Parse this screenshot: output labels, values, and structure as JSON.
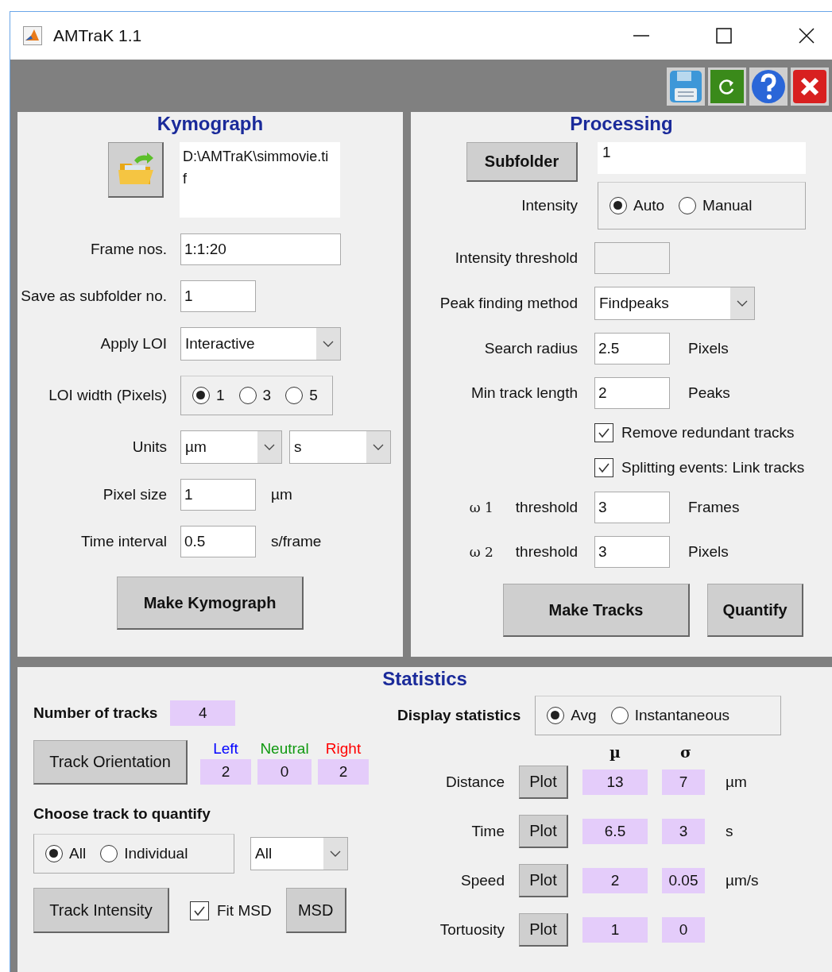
{
  "window": {
    "title": "AMTraK 1.1"
  },
  "toolbar": [
    {
      "kind": "save"
    },
    {
      "kind": "refresh"
    },
    {
      "kind": "help"
    },
    {
      "kind": "close"
    }
  ],
  "kymograph": {
    "title": "Kymograph",
    "file_path": "D:\\AMTraK\\simmovie.tif",
    "rows": [
      {
        "kind": "wide_text",
        "label": "Frame nos.",
        "value": "1:1:20"
      },
      {
        "kind": "text",
        "label": "Save as subfolder no.",
        "value": "1"
      },
      {
        "kind": "dropdown",
        "label": "Apply  LOI",
        "values": [
          "Interactive"
        ]
      },
      {
        "kind": "radio",
        "label": "LOI width (Pixels)",
        "options": [
          {
            "label": "1",
            "selected": true
          },
          {
            "label": "3",
            "selected": false
          },
          {
            "label": "5",
            "selected": false
          }
        ]
      },
      {
        "kind": "dropdown",
        "label": "Units",
        "values": [
          "µm",
          "s"
        ]
      },
      {
        "kind": "text",
        "label": "Pixel size",
        "value": "1",
        "unit": "µm"
      },
      {
        "kind": "text",
        "label": "Time interval",
        "value": "0.5",
        "unit": "s/frame"
      }
    ],
    "button": "Make Kymograph"
  },
  "processing": {
    "title": "Processing",
    "subfolder_button": "Subfolder",
    "subfolder_value": "1",
    "rows": [
      {
        "kind": "radio",
        "label": "Intensity",
        "options": [
          {
            "label": "Auto",
            "selected": true
          },
          {
            "label": "Manual",
            "selected": false
          }
        ]
      },
      {
        "kind": "text",
        "label": "Intensity threshold",
        "disabled": true
      },
      {
        "kind": "dropdown",
        "label": "Peak finding method",
        "values": [
          "Findpeaks"
        ]
      },
      {
        "kind": "text",
        "label": "Search radius",
        "value": "2.5",
        "unit": "Pixels"
      },
      {
        "kind": "text",
        "label": "Min track length",
        "value": "2",
        "unit": "Peaks"
      },
      {
        "kind": "checkbox",
        "label": "Remove redundant tracks",
        "checked": true
      },
      {
        "kind": "checkbox",
        "label": "Splitting events: Link tracks",
        "checked": true
      },
      {
        "kind": "text",
        "symbol": "ω 1",
        "label": "threshold",
        "value": "3",
        "unit": "Frames"
      },
      {
        "kind": "text",
        "symbol": "ω 2",
        "label": "threshold",
        "value": "3",
        "unit": "Pixels"
      }
    ],
    "buttons": [
      "Make Tracks",
      "Quantify"
    ]
  },
  "statistics": {
    "title": "Statistics",
    "number_of_tracks": {
      "label": "Number of tracks",
      "value": "4"
    },
    "orientation_button": "Track Orientation",
    "orientation": [
      {
        "label": "Left",
        "value": "2",
        "color": "#0000ff"
      },
      {
        "label": "Neutral",
        "value": "0",
        "color": "#119911"
      },
      {
        "label": "Right",
        "value": "2",
        "color": "#ff0000"
      }
    ],
    "choose_label": "Choose track to quantify",
    "choose_options": [
      {
        "label": "All",
        "selected": true
      },
      {
        "label": "Individual",
        "selected": false
      }
    ],
    "track_dropdown": "All",
    "intensity_button": "Track Intensity",
    "fit_msd": {
      "label": "Fit MSD",
      "checked": true
    },
    "msd_button": "MSD",
    "display_label": "Display statistics",
    "display_options": [
      {
        "label": "Avg",
        "selected": true
      },
      {
        "label": "Instantaneous",
        "selected": false
      }
    ],
    "headers": [
      "µ",
      "σ"
    ],
    "rows": [
      {
        "label": "Distance",
        "button": "Plot",
        "mean": "13",
        "sd": "7",
        "unit": "µm"
      },
      {
        "label": "Time",
        "button": "Plot",
        "mean": "6.5",
        "sd": "3",
        "unit": "s"
      },
      {
        "label": "Speed",
        "button": "Plot",
        "mean": "2",
        "sd": "0.05",
        "unit": "µm/s"
      },
      {
        "label": "Tortuosity",
        "button": "Plot",
        "mean": "1",
        "sd": "0"
      }
    ]
  }
}
